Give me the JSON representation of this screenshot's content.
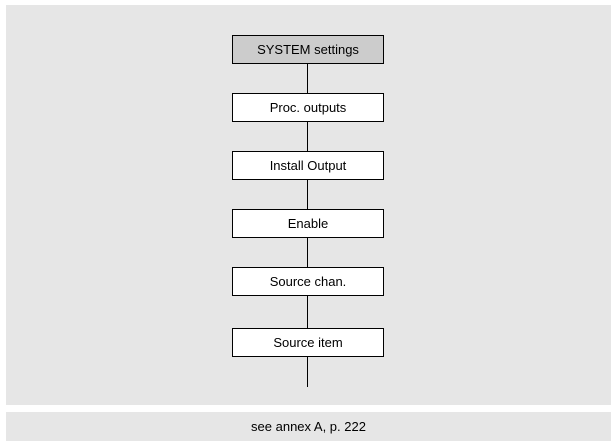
{
  "colors": {
    "panel_bg": "#e6e6e6",
    "header_node_bg": "#cccccc",
    "node_bg": "#ffffff",
    "line": "#000000"
  },
  "flow": {
    "nodes": [
      {
        "label": "SYSTEM settings"
      },
      {
        "label": "Proc. outputs"
      },
      {
        "label": "Install Output"
      },
      {
        "label": "Enable"
      },
      {
        "label": "Source chan."
      },
      {
        "label": "Source item"
      }
    ]
  },
  "footer": {
    "text": "see annex A, p. 222"
  }
}
